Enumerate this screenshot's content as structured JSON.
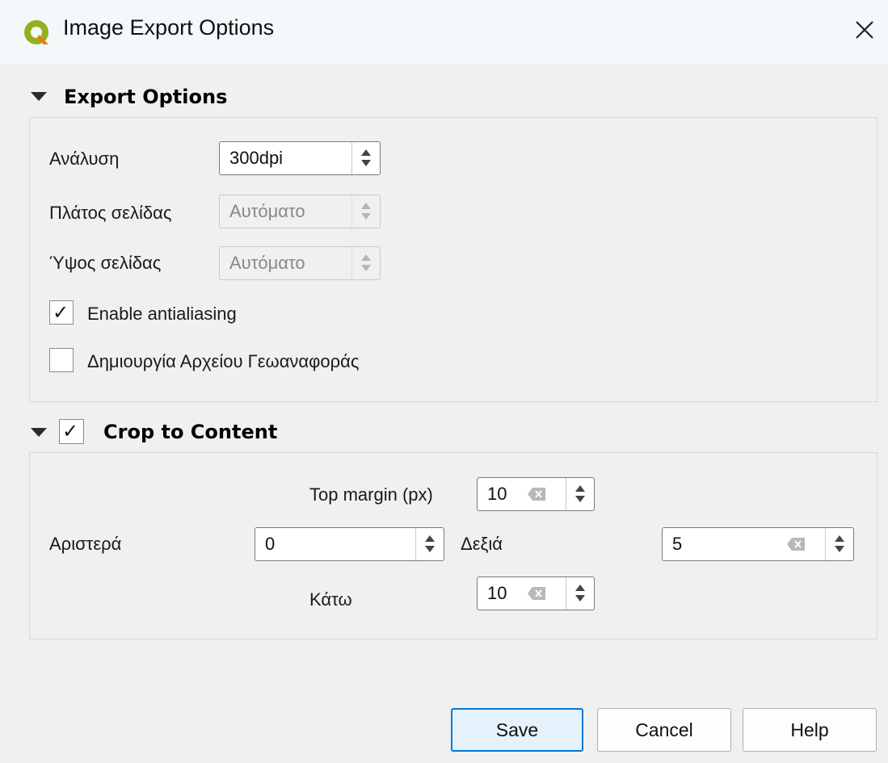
{
  "window": {
    "title": "Image Export Options",
    "close_glyph": "✕",
    "icon": "qgis-logo-icon"
  },
  "export_options": {
    "header": "Export Options",
    "resolution": {
      "label": "Ανάλυση",
      "value": "300dpi"
    },
    "page_width": {
      "label": "Πλάτος σελίδας",
      "value": "Αυτόματο",
      "enabled": false
    },
    "page_height": {
      "label": "Ύψος σελίδας",
      "value": "Αυτόματο",
      "enabled": false
    },
    "antialiasing": {
      "label": "Enable antialiasing",
      "checked": true
    },
    "world_file": {
      "label": "Δημιουργία Αρχείου Γεωαναφοράς",
      "checked": false
    }
  },
  "crop": {
    "header": "Crop to Content",
    "checked": true,
    "top_margin": {
      "label": "Top margin (px)",
      "value": "10"
    },
    "left": {
      "label": "Αριστερά",
      "value": "0"
    },
    "right": {
      "label": "Δεξιά",
      "value": "5"
    },
    "bottom": {
      "label": "Κάτω",
      "value": "10"
    }
  },
  "buttons": {
    "save": "Save",
    "cancel": "Cancel",
    "help": "Help"
  },
  "colors": {
    "accent": "#0078d7",
    "titlebar": "#f3f8fb",
    "background": "#f0f0f0"
  }
}
